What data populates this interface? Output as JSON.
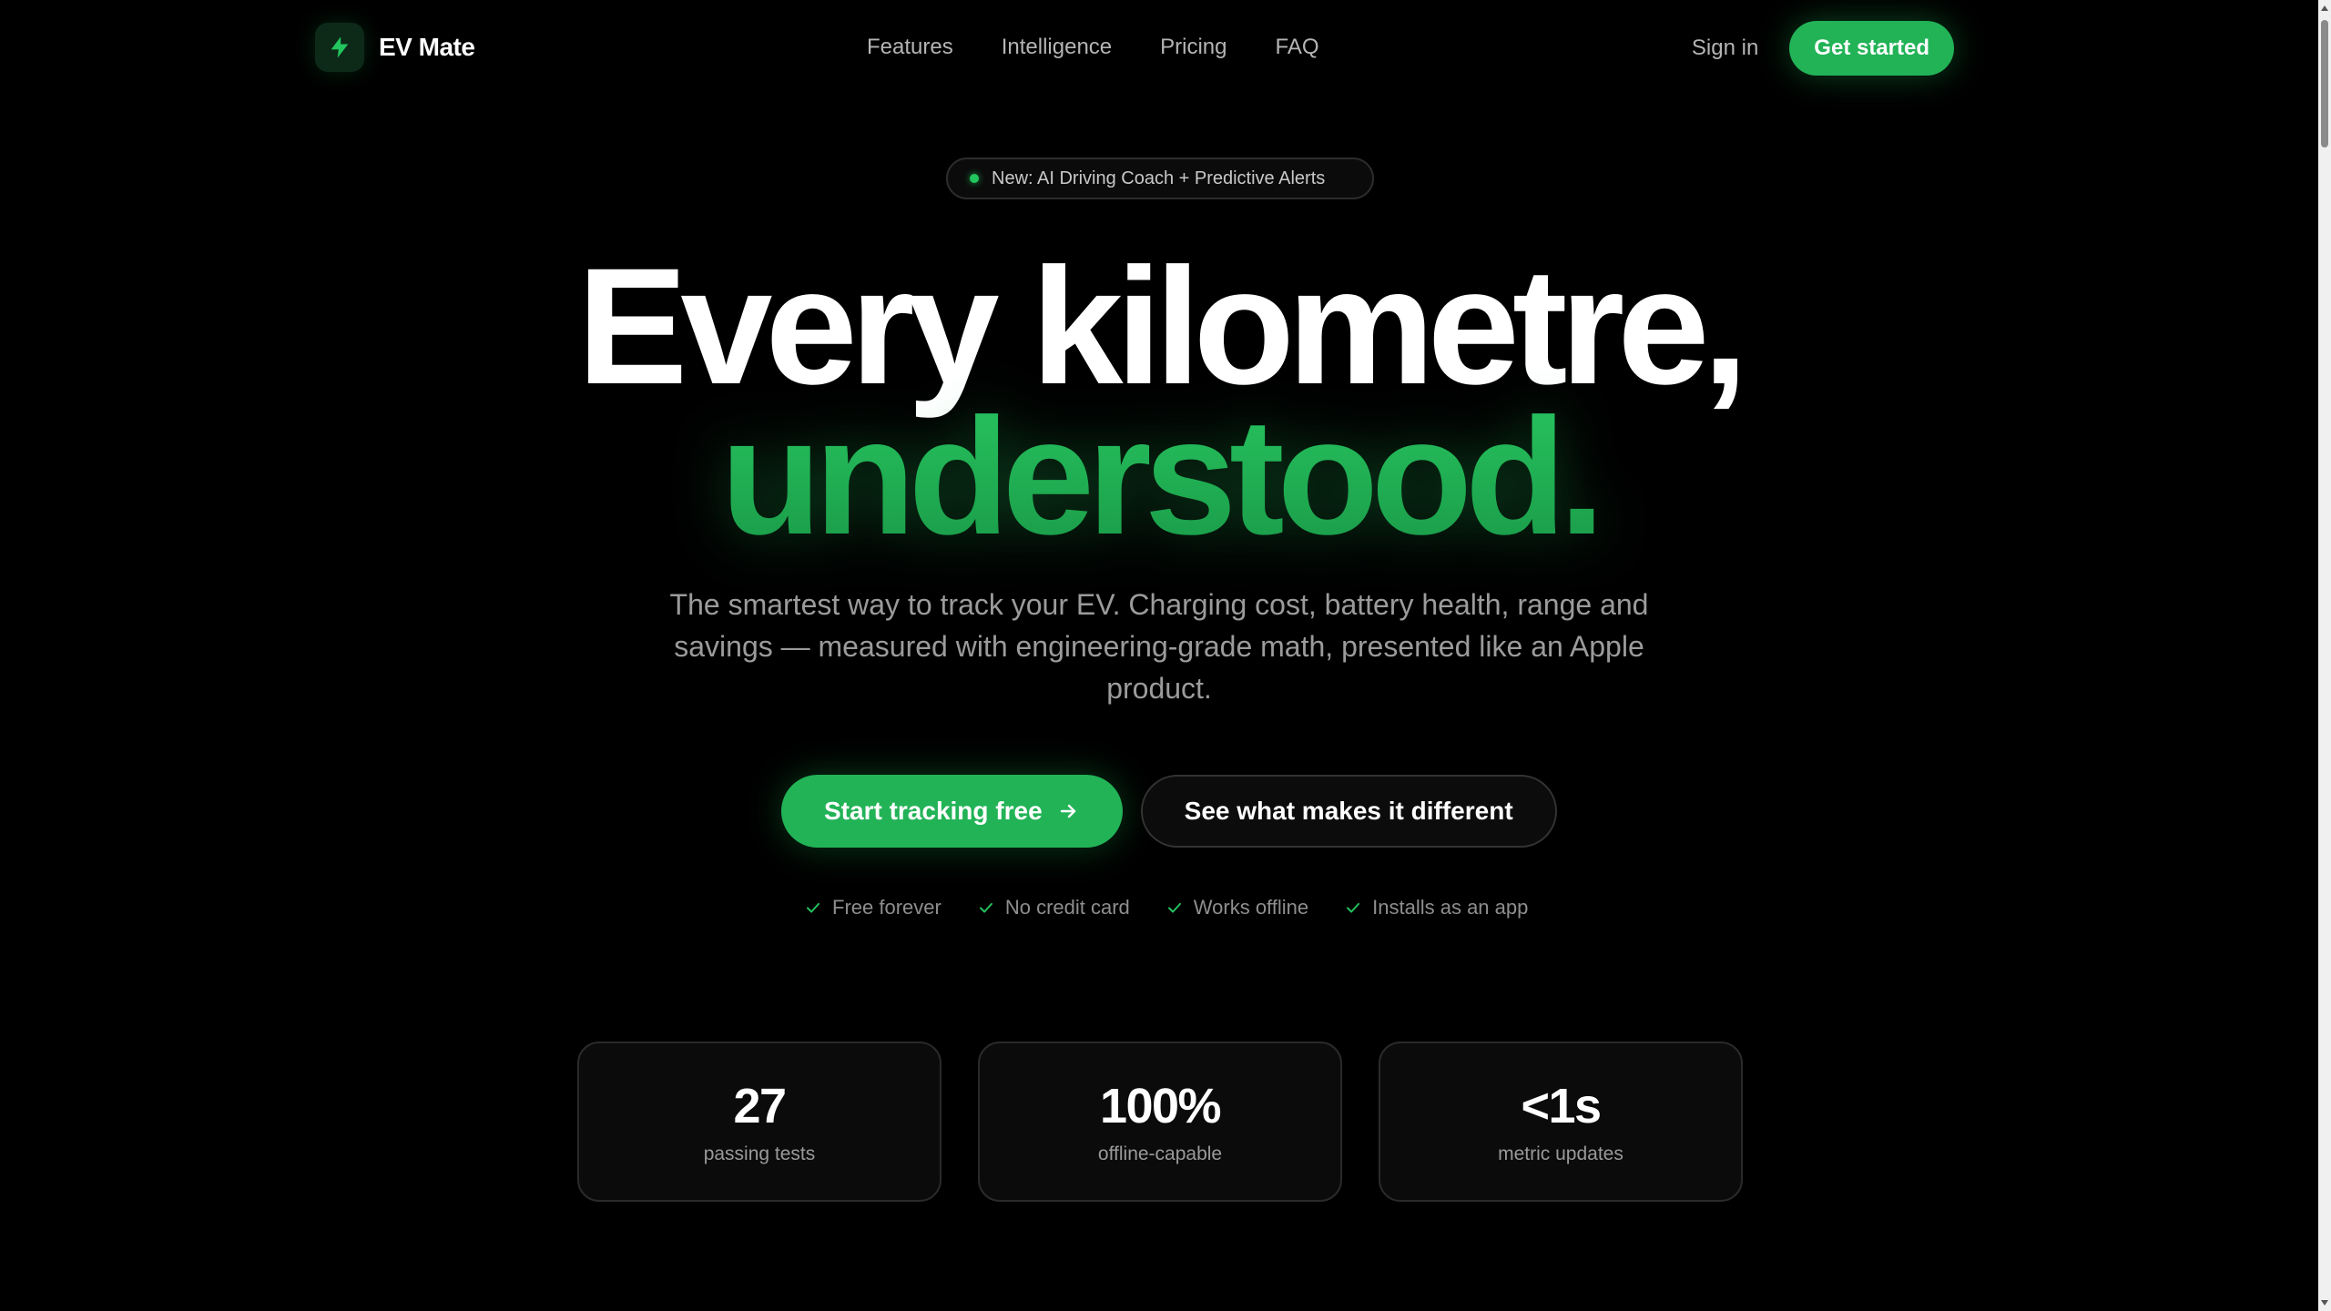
{
  "app": {
    "name": "EV Mate",
    "accent_color": "#22b357",
    "background_color": "#000000",
    "logo_icon": "lightning-bolt-icon"
  },
  "nav": {
    "links": [
      "Features",
      "Intelligence",
      "Pricing",
      "FAQ"
    ],
    "sign_in": "Sign in",
    "get_started": "Get started"
  },
  "hero": {
    "badge": "New: AI Driving Coach + Predictive Alerts",
    "headline_line1": "Every kilometre,",
    "headline_line2": "understood.",
    "subtitle": "The smartest way to track your EV. Charging cost, battery health, range and savings — measured with engineering-grade math, presented like an Apple product.",
    "primary_cta": "Start tracking free",
    "primary_cta_icon": "arrow-right-icon",
    "secondary_cta": "See what makes it different",
    "checks": [
      "Free forever",
      "No credit card",
      "Works offline",
      "Installs as an app"
    ],
    "check_icon": "check-icon"
  },
  "stats": [
    {
      "value": "27",
      "label": "passing tests"
    },
    {
      "value": "100%",
      "label": "offline-capable"
    },
    {
      "value": "<1s",
      "label": "metric updates"
    }
  ]
}
